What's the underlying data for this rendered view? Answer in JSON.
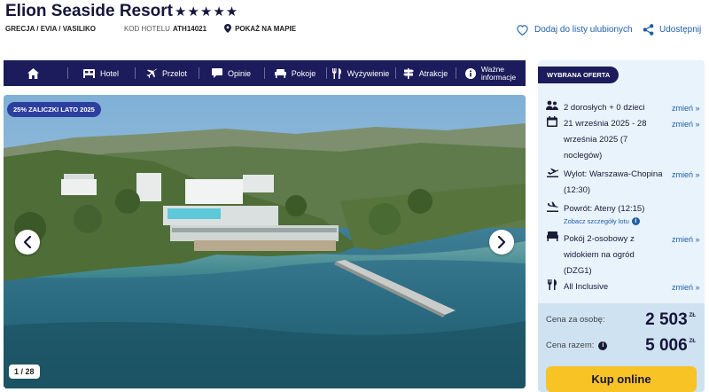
{
  "header": {
    "title": "Elion Seaside Resort",
    "stars": "★★★★★",
    "location": "GRECJA / EVIA / VASILIKO",
    "code_label": "KOD HOTELU",
    "code": "ATH14021",
    "map_label": "POKAŻ NA MAPIE",
    "favorite_label": "Dodaj do listy ulubionych",
    "share_label": "Udostępnij"
  },
  "nav": {
    "hotel": "Hotel",
    "flight": "Przelot",
    "reviews": "Opinie",
    "rooms": "Pokoje",
    "food": "Wyżywienie",
    "attractions": "Atrakcje",
    "info_line1": "Ważne",
    "info_line2": "informacje"
  },
  "gallery": {
    "promo": "25% ZALICZKI LATO 2025",
    "counter": "1 / 28"
  },
  "offer": {
    "badge": "WYBRANA OFERTA",
    "change_label": "zmień »",
    "guests": "2 dorosłych + 0 dzieci",
    "dates": "21 września 2025 - 28 września 2025 (7 noclegów)",
    "departure": "Wylot: Warszawa-Chopina (12:30)",
    "return": "Powrót: Ateny (12:15)",
    "flight_details": "Zobacz szczegóły lotu",
    "room": "Pokój 2-osobowy z widokiem na ogród (DZG1)",
    "board": "All Inclusive",
    "price_per_person_label": "Cena za osobę:",
    "price_per_person": "2 503",
    "total_label": "Cena razem:",
    "total": "5 006",
    "currency": "ZŁ",
    "book_label": "Kup online"
  },
  "colors": {
    "navy": "#1c1c5c",
    "accent_yellow": "#f7c325",
    "link_blue": "#1f5fa8",
    "panel_bg": "#e9f3fb"
  }
}
